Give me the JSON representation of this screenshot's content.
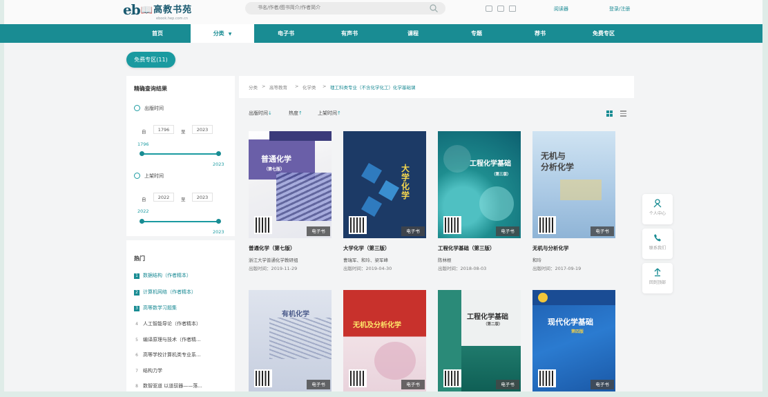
{
  "header": {
    "logo_text": "eb",
    "logo_cn": "高教书苑",
    "logo_sub": "ebook.hep.com.cn",
    "search_placeholder": "书名/作者/图书简介/作者简介",
    "reader_link": "阅读器",
    "login_link": "登录/注册"
  },
  "nav": {
    "items": [
      {
        "label": "首页"
      },
      {
        "label": "分类"
      },
      {
        "label": "电子书"
      },
      {
        "label": "有声书"
      },
      {
        "label": "课程"
      },
      {
        "label": "专题"
      },
      {
        "label": "荐书"
      },
      {
        "label": "免费专区"
      }
    ],
    "active_index": 1
  },
  "free_zone_button": "免费专区(11)",
  "filter": {
    "title": "精确查询结果",
    "pub_time": {
      "label": "出版时间",
      "from_label": "自",
      "to_label": "至",
      "from": "1796",
      "to": "2023",
      "range_min": "1796",
      "range_max": "2023"
    },
    "shelf_time": {
      "label": "上架时间",
      "from_label": "自",
      "to_label": "至",
      "from": "2022",
      "to": "2023",
      "range_min": "2022",
      "range_max": "2023"
    }
  },
  "hot": {
    "title": "热门",
    "items": [
      {
        "rank": "1",
        "label": "数据结构（作者精本）"
      },
      {
        "rank": "2",
        "label": "计算机网络（作者精本）"
      },
      {
        "rank": "3",
        "label": "高等数学习题集"
      },
      {
        "rank": "4",
        "label": "人工智能导论（作者精本）"
      },
      {
        "rank": "5",
        "label": "编译原理与技术（作者精..."
      },
      {
        "rank": "6",
        "label": "高等学校计算机类专业系..."
      },
      {
        "rank": "7",
        "label": "结构力学"
      },
      {
        "rank": "8",
        "label": "数智驱道 以道驭器——落..."
      }
    ]
  },
  "breadcrumb": {
    "items": [
      "分类",
      "高等教育",
      "化学类"
    ],
    "current": "理工科类专业（不含化学化工）化学基础课",
    "separator": ">"
  },
  "sort": {
    "options": [
      {
        "label": "出版时间",
        "arrow": "↓"
      },
      {
        "label": "热度",
        "arrow": "↑"
      },
      {
        "label": "上架时间",
        "arrow": "↑"
      }
    ]
  },
  "books": [
    {
      "title": "普通化学（第七版）",
      "author": "浙江大学普通化学教研组",
      "date": "出版时间：2019-11-29",
      "tag": "电子书",
      "cover_title": "普通化学",
      "cover_sub": "（第七版）"
    },
    {
      "title": "大学化学（第三版）",
      "author": "曹瑞军、和玲、梁军峰",
      "date": "出版时间：2019-04-30",
      "tag": "电子书",
      "cover_title": "大学化学"
    },
    {
      "title": "工程化学基础（第三版）",
      "author": "陈林根",
      "date": "出版时间：2018-08-03",
      "tag": "电子书",
      "cover_title": "工程化学基础",
      "cover_sub": "（第三版）"
    },
    {
      "title": "无机与分析化学",
      "author": "和玲",
      "date": "出版时间：2017-09-19",
      "tag": "电子书",
      "cover_title": "无机与\n分析化学"
    },
    {
      "title": "",
      "tag": "电子书",
      "cover_title": "有机化学"
    },
    {
      "title": "",
      "tag": "电子书",
      "cover_title": "无机及分析化学"
    },
    {
      "title": "",
      "tag": "电子书",
      "cover_title": "工程化学基础",
      "cover_sub": "（第二版）"
    },
    {
      "title": "",
      "tag": "电子书",
      "cover_title": "现代化学基础",
      "cover_sub": "第四版"
    }
  ],
  "float_bar": {
    "personal": "个人中心",
    "contact": "联系我们",
    "top": "回到顶部"
  }
}
